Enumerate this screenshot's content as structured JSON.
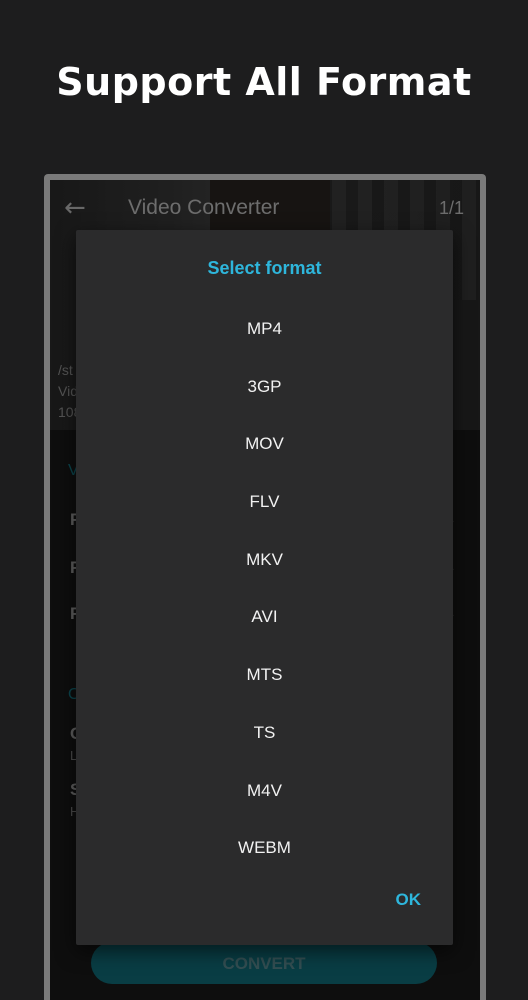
{
  "promo": {
    "title": "Support All Format"
  },
  "app": {
    "title": "Video Converter",
    "page_count": "1/1",
    "file_info": {
      "line1": "/st",
      "line2": "Vid",
      "line3": "108"
    },
    "rows": [
      "F",
      "F",
      "F"
    ],
    "section_a": "V",
    "section_b": "O",
    "option_c": {
      "label": "C",
      "sub": "L"
    },
    "option_s": {
      "label": "S",
      "sub": "H"
    },
    "convert_label": "CONVERT"
  },
  "dialog": {
    "title": "Select format",
    "formats": [
      "MP4",
      "3GP",
      "MOV",
      "FLV",
      "MKV",
      "AVI",
      "MTS",
      "TS",
      "M4V",
      "WEBM"
    ],
    "ok_label": "OK"
  },
  "colors": {
    "accent": "#2eb6dc",
    "button_teal": "#11707c",
    "dialog_bg": "#2b2b2c",
    "page_bg": "#1d1d1e"
  },
  "icons": {
    "back": "back-arrow-icon"
  }
}
